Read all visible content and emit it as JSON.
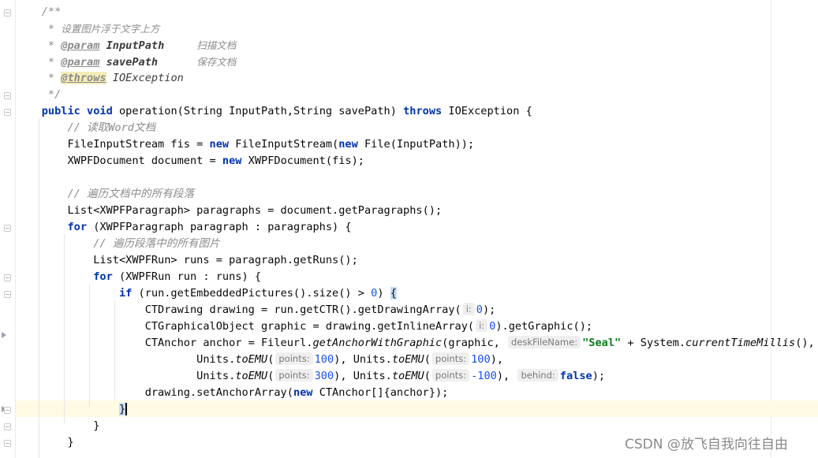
{
  "code": {
    "doc_open": "/**",
    "doc_star": "*",
    "doc_line1": "设置图片浮于文字上方",
    "doc_param_tag": "@param",
    "doc_param1_name": "InputPath",
    "doc_param1_desc": "扫描文档",
    "doc_param2_name": "savePath",
    "doc_param2_desc": "保存文档",
    "doc_throws_tag": "@throws",
    "doc_throws_name": "IOException",
    "doc_close": "*/",
    "kw_public": "public",
    "kw_void": "void",
    "method_signature": "operation(String InputPath,String savePath)",
    "kw_throws": "throws",
    "sig_rest": "IOException {",
    "comment_read": "// 读取Word文档",
    "line_fis_a": "FileInputStream fis = ",
    "kw_new": "new",
    "line_fis_b": "FileInputStream(",
    "line_fis_c": "File(InputPath));",
    "line_doc_a": "XWPFDocument document = ",
    "line_doc_b": "XWPFDocument(fis);",
    "comment_paragraphs": "// 遍历文档中的所有段落",
    "line_paragraphs": "List<XWPFParagraph> paragraphs = document.getParagraphs();",
    "kw_for": "for",
    "line_for1": "(XWPFParagraph paragraph : paragraphs) {",
    "comment_pictures": "// 遍历段落中的所有图片",
    "line_runs": "List<XWPFRun> runs = paragraph.getRuns();",
    "line_for2": "(XWPFRun run : runs) {",
    "kw_if": "if",
    "line_if_a": "(run.getEmbeddedPictures().size() > ",
    "num_0": "0",
    "line_if_b": ") ",
    "open_brace": "{",
    "line_drawing_a": "CTDrawing drawing = run.getCTR().getDrawingArray(",
    "hint_i": "i:",
    "line_drawing_b": ");",
    "line_graphic_a": "CTGraphicalObject graphic = drawing.getInlineArray(",
    "line_graphic_b": ").getGraphic();",
    "line_anchor_a": "CTAnchor anchor = Fileurl.",
    "method_getAnchor": "getAnchorWithGraphic",
    "line_anchor_b": "(graphic, ",
    "hint_deskFileName": "deskFileName:",
    "str_seal": "\"Seal\"",
    "line_anchor_c": " + System.",
    "method_ctm": "currentTimeMillis",
    "line_anchor_d": "(),",
    "units": "Units.",
    "method_toEMU": "toEMU",
    "paren_open": "(",
    "hint_points": "points:",
    "num_100": "100",
    "num_300": "300",
    "num_neg100": "-100",
    "sep": "), ",
    "sep_end": "),",
    "hint_behind": "behind:",
    "kw_false": "false",
    "close_call": ");",
    "line_set": "drawing.setAnchorArray(",
    "line_set_b": "CTAnchor[]{anchor});",
    "close_brace": "}"
  },
  "watermark": "CSDN @放飞自我向往自由"
}
